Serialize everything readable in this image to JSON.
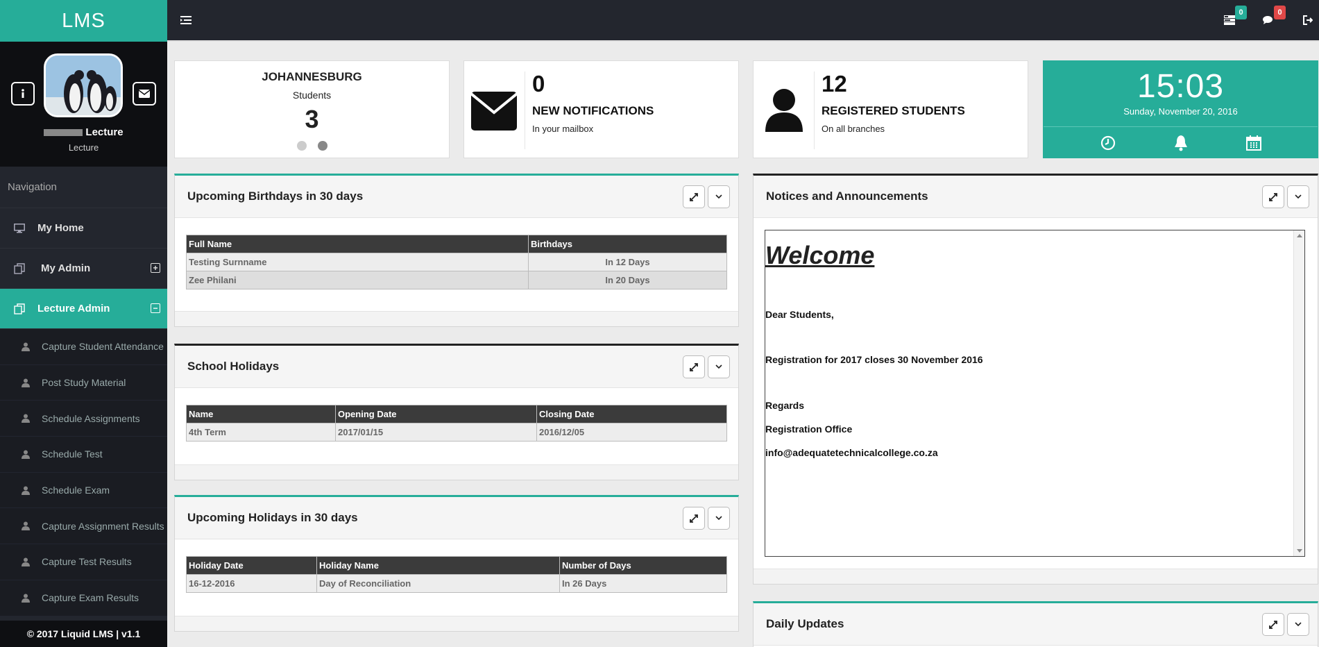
{
  "brand": "LMS",
  "profile": {
    "name": "Lecture",
    "role": "Lecture"
  },
  "nav": {
    "heading": "Navigation",
    "items": [
      {
        "label": "My Home"
      },
      {
        "label": "My Admin"
      },
      {
        "label": "Lecture Admin"
      }
    ],
    "sub": [
      "Capture Student Attendance",
      "Post Study Material",
      "Schedule Assignments",
      "Schedule Test",
      "Schedule Exam",
      "Capture Assignment Results",
      "Capture Test Results",
      "Capture Exam Results"
    ]
  },
  "footer": "© 2017 Liquid LMS | v1.1",
  "topbar": {
    "tasks_badge": "0",
    "messages_badge": "0"
  },
  "stats": {
    "branch": {
      "title": "JOHANNESBURG",
      "label": "Students",
      "value": "3"
    },
    "notifications": {
      "value": "0",
      "title": "NEW NOTIFICATIONS",
      "sub": "In your mailbox"
    },
    "students": {
      "value": "12",
      "title": "REGISTERED STUDENTS",
      "sub": "On all branches"
    },
    "clock": {
      "time": "15:03",
      "date": "Sunday, November 20, 2016"
    }
  },
  "birthdays": {
    "title": "Upcoming Birthdays in 30 days",
    "headers": [
      "Full Name",
      "Birthdays"
    ],
    "rows": [
      [
        "Testing Surnname",
        "In 12 Days"
      ],
      [
        "Zee Philani",
        "In 20 Days"
      ]
    ]
  },
  "school_holidays": {
    "title": "School Holidays",
    "headers": [
      "Name",
      "Opening Date",
      "Closing Date"
    ],
    "rows": [
      [
        "4th Term",
        "2017/01/15",
        "2016/12/05"
      ]
    ]
  },
  "upcoming_holidays": {
    "title": "Upcoming Holidays in 30 days",
    "headers": [
      "Holiday Date",
      "Holiday Name",
      "Number of Days"
    ],
    "rows": [
      [
        "16-12-2016",
        "Day of Reconciliation",
        "In 26 Days"
      ]
    ]
  },
  "notices": {
    "title": "Notices and Announcements",
    "heading": "Welcome",
    "lines": [
      "Dear Students,",
      "Registration for 2017 closes 30 November 2016",
      "Regards",
      "Registration Office",
      "info@adequatetechnicalcollege.co.za"
    ]
  },
  "daily": {
    "title": "Daily Updates"
  },
  "colors": {
    "accent": "#26ad99",
    "sidebar": "#23262e",
    "badge_green": "#26ad99",
    "badge_red": "#e04848"
  }
}
